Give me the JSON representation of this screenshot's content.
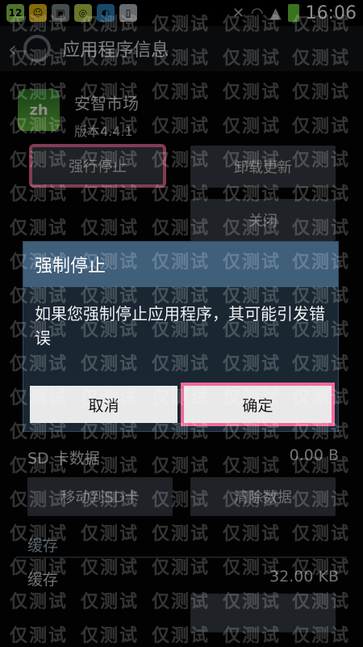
{
  "status": {
    "time": "16:06",
    "badge": "12"
  },
  "header": {
    "title": "应用程序信息"
  },
  "app": {
    "name": "安智市场",
    "version": "版本4.4.1"
  },
  "buttons": {
    "force_stop": "强行停止",
    "uninstall_update": "卸载更新",
    "close": "关闭",
    "move_to_sd": "移动到SD卡",
    "clear_data": "清除数据"
  },
  "storage": {
    "sd_label": "SD 卡数据",
    "sd_value": "0.00 B",
    "cache_section": "缓存",
    "cache_label": "缓存",
    "cache_value": "32.00 KB"
  },
  "dialog": {
    "title": "强制停止",
    "message": "如果您强制停止应用程序，其可能引发错误",
    "cancel": "取消",
    "confirm": "确定"
  },
  "watermark_text": "仅测试"
}
